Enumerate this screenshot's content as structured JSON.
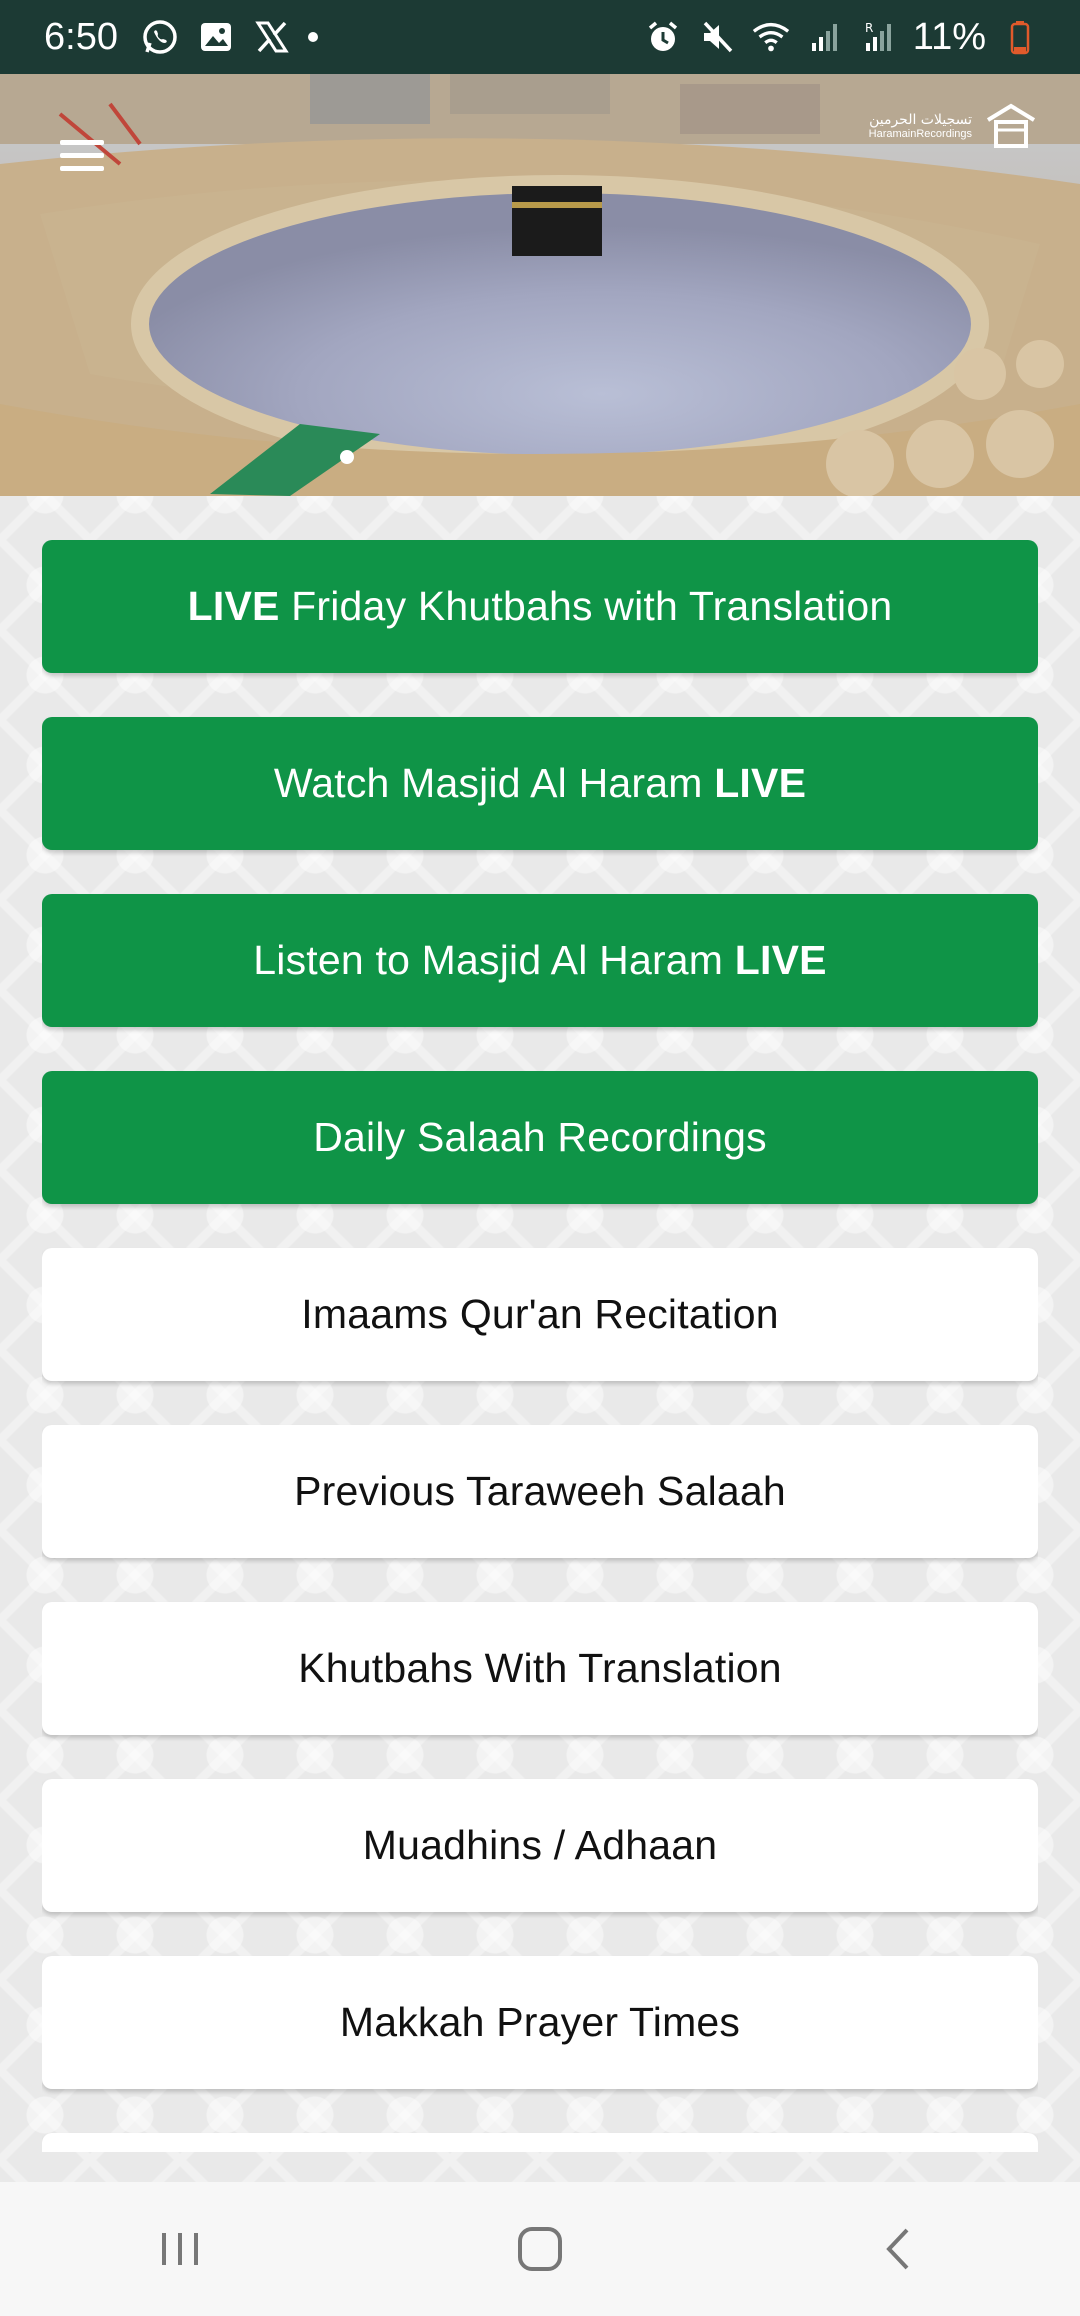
{
  "status_bar": {
    "time": "6:50",
    "battery": "11%",
    "left_icons": [
      "whatsapp-icon",
      "gallery-icon",
      "x-icon",
      "notification-dot"
    ],
    "right_icons": [
      "alarm-icon",
      "mute-icon",
      "wifi-icon",
      "signal-icon",
      "signal-roaming-icon",
      "battery-icon"
    ]
  },
  "hero": {
    "logo_latin": "HaramainRecordings",
    "logo_arabic": "تسجيلات الحرمين",
    "slide_count": 1,
    "active_slide": 1
  },
  "menu": [
    {
      "parts": [
        {
          "text": "LIVE",
          "bold": true
        },
        {
          "text": " Friday Khutbahs with Translation",
          "bold": false
        }
      ],
      "style": "green"
    },
    {
      "parts": [
        {
          "text": "Watch Masjid Al Haram ",
          "bold": false
        },
        {
          "text": "LIVE",
          "bold": true
        }
      ],
      "style": "green"
    },
    {
      "parts": [
        {
          "text": "Listen to Masjid Al Haram ",
          "bold": false
        },
        {
          "text": "LIVE",
          "bold": true
        }
      ],
      "style": "green"
    },
    {
      "parts": [
        {
          "text": "Daily Salaah Recordings",
          "bold": false
        }
      ],
      "style": "green"
    },
    {
      "parts": [
        {
          "text": "Imaams Qur'an Recitation",
          "bold": false
        }
      ],
      "style": "white"
    },
    {
      "parts": [
        {
          "text": "Previous Taraweeh Salaah",
          "bold": false
        }
      ],
      "style": "white"
    },
    {
      "parts": [
        {
          "text": "Khutbahs With Translation",
          "bold": false
        }
      ],
      "style": "white"
    },
    {
      "parts": [
        {
          "text": "Muadhins / Adhaan",
          "bold": false
        }
      ],
      "style": "white"
    },
    {
      "parts": [
        {
          "text": "Makkah Prayer Times",
          "bold": false
        }
      ],
      "style": "white"
    },
    {
      "parts": [
        {
          "text": "",
          "bold": false
        }
      ],
      "style": "white"
    }
  ],
  "colors": {
    "green": "#0f9447",
    "status_bar": "#1c3a34"
  },
  "nav_bar": [
    "recents-icon",
    "home-icon",
    "back-icon"
  ]
}
